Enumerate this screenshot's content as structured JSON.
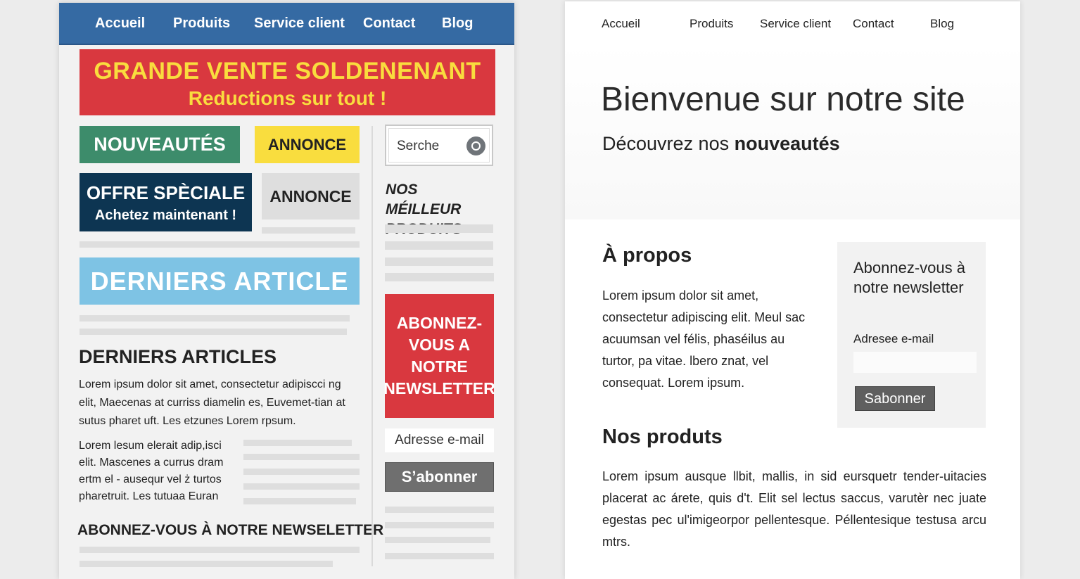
{
  "left_page": {
    "nav": [
      "Accueil",
      "Produits",
      "Service client",
      "Contact",
      "Blog"
    ],
    "banner": {
      "title": "GRANDE VENTE SOLDENENANT",
      "subtitle": "Reductions sur tout !"
    },
    "tiles": {
      "nouveautes": "NOUVEAUTÉS",
      "annonce1": "ANNONCE",
      "offre_title": "OFFRE SPÈCIALE",
      "offre_sub": "Achetez maintenant !",
      "annonce2": "ANNONCE",
      "derniers_banner": "DERNIERS ARTICLE"
    },
    "search": {
      "placeholder": "Serche"
    },
    "best_products": "NOS MÉILLEUR PRODUITS",
    "subscribe_box": "ABONNEZ-VOUS A NOTRE NEWSLETTER",
    "email_placeholder": "Adresse e-mail",
    "subscribe_button": "S’abonner",
    "articles_heading": "DERNIERS ARTICLES",
    "articles_text1": "Lorem ipsum dolor sit amet, consectetur adipiscci ng elit, Maecenas at curriss diamelin es, Euvemet-tian at sutus pharet uft. Les etzunes Lorem rpsum.",
    "articles_text2": "Lorem lesum elerait adip,isci elit. Mascenes a currus dram ertm el - ausequr vel ż turtos pharetruit. Les tutuaa Euran",
    "newsletter_footer": "ABONNEZ-VOUS À NOTRE NEWSELETTER",
    "colors": {
      "nav": "#356aa3",
      "red": "#d9383f",
      "yellow": "#f9dd3e",
      "green": "#3d8c6b",
      "navy": "#0d3552",
      "lightblue": "#7ec3e4"
    }
  },
  "right_page": {
    "nav": [
      "Accueil",
      "Produits",
      "Service client",
      "Contact",
      "Blog"
    ],
    "hero_title": "Bienvenue sur notre site",
    "hero_sub_prefix": "Découvrez nos",
    "hero_sub_bold": "nouveautés",
    "about_heading": "À propos",
    "about_text": "Lorem ipsum dolor sit amet, consectetur adipiscing elit. Meul sac acuumsan vel félis, phaséilus au turtor, pa vitae. lbero znat, vel consequat. Lorem ipsum.",
    "newsletter_title": "Abonnez-vous à notre newsletter",
    "email_label": "Adresee e-mail",
    "subscribe_button": "Sabonner",
    "products_heading": "Nos produts",
    "products_text": "Lorem ipsum ausque llbit, mallis, in sid eursquetr tender-uitacies placerat ac árete, quis d't. Elit sel lectus saccus, varutèr nec juate egestas pec ul'imigeorpor pellentesque. Péllentesique testusa arcu mtrs."
  }
}
